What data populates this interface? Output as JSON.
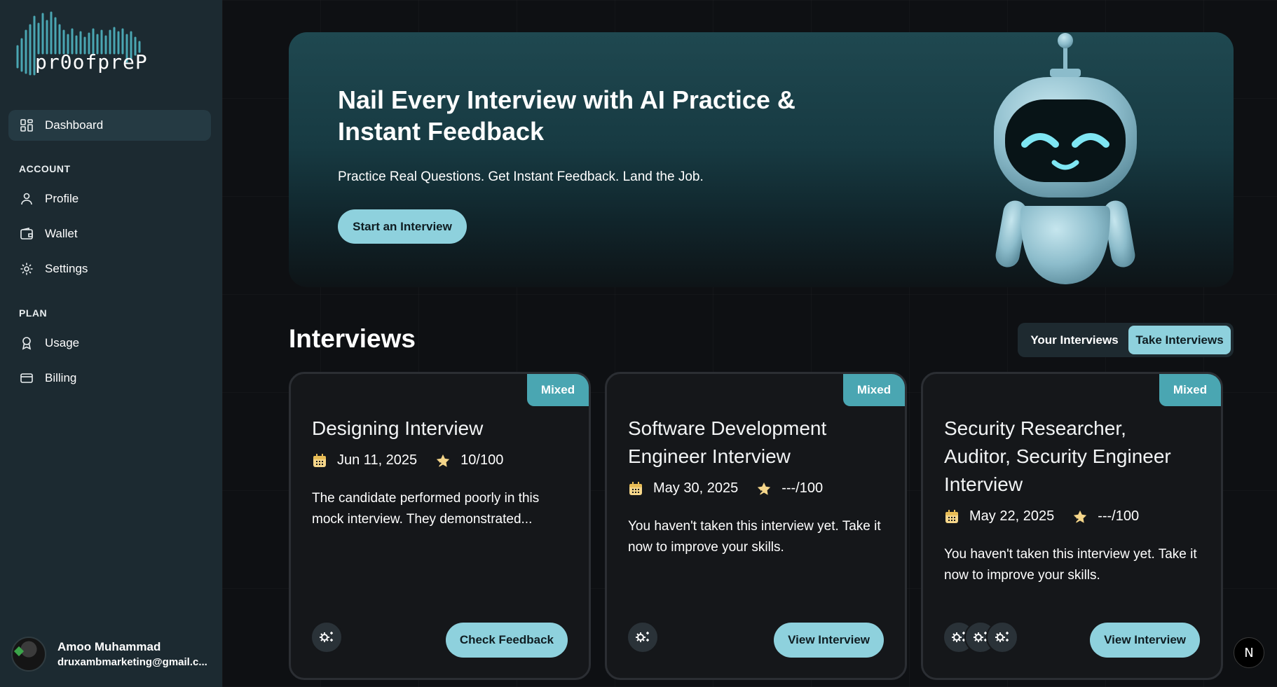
{
  "brand": {
    "name": "pr0ofpreP",
    "accent": "#8ed1dd",
    "badge_color": "#4aa6b2"
  },
  "sidebar": {
    "dashboard": "Dashboard",
    "account_label": "ACCOUNT",
    "account_items": [
      {
        "label": "Profile",
        "icon": "user-icon"
      },
      {
        "label": "Wallet",
        "icon": "wallet-icon"
      },
      {
        "label": "Settings",
        "icon": "gear-icon"
      }
    ],
    "plan_label": "PLAN",
    "plan_items": [
      {
        "label": "Usage",
        "icon": "ribbon-icon"
      },
      {
        "label": "Billing",
        "icon": "credit-card-icon"
      }
    ],
    "user": {
      "name": "Amoo Muhammad",
      "email": "druxambmarketing@gmail.c..."
    }
  },
  "hero": {
    "title": "Nail Every Interview with AI Practice & Instant Feedback",
    "subtitle": "Practice Real Questions. Get Instant Feedback. Land the Job.",
    "cta": "Start an Interview"
  },
  "interviews": {
    "title": "Interviews",
    "tabs": [
      "Your Interviews",
      "Take Interviews"
    ],
    "active_tab": "Take Interviews",
    "cards": [
      {
        "badge": "Mixed",
        "title": "Designing Interview",
        "date": "Jun 11, 2025",
        "score": "10/100",
        "description": "The candidate performed poorly in this mock interview. They demonstrated...",
        "button": "Check Feedback"
      },
      {
        "badge": "Mixed",
        "title": "Software Development Engineer Interview",
        "date": "May 30, 2025",
        "score": "---/100",
        "description": "You haven't taken this interview yet. Take it now to improve your skills.",
        "button": "View Interview"
      },
      {
        "badge": "Mixed",
        "title": "Security Researcher, Auditor, Security Engineer Interview",
        "date": "May 22, 2025",
        "score": "---/100",
        "description": "You haven't taken this interview yet. Take it now to improve your skills.",
        "button": "View Interview"
      }
    ]
  },
  "dev_badge": "N"
}
